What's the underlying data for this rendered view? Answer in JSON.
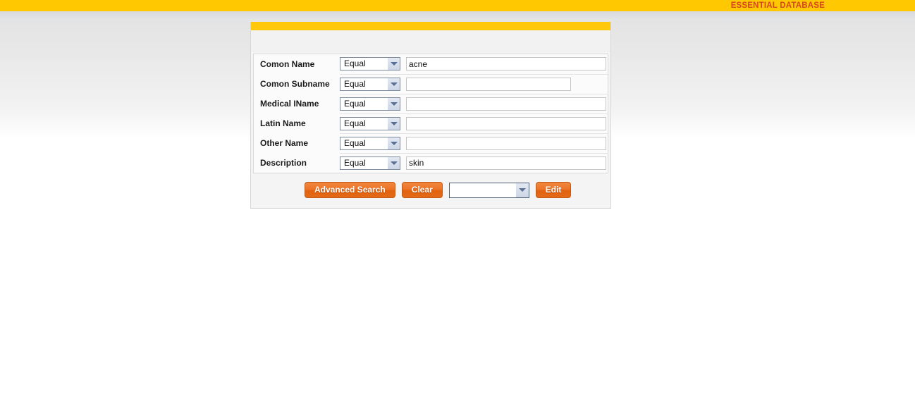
{
  "top_bar": {
    "title": "ESSENTIAL DATABASE",
    "background_color": "#FFC800",
    "text_color": "#D6451C"
  },
  "panel": {
    "header_color": "#FFC80B",
    "background_color": "#f4f4f4"
  },
  "form": {
    "operator_options": [
      "Equal"
    ],
    "rows": [
      {
        "label": "Comon Name",
        "operator": "Equal",
        "value": "acne",
        "placeholder": "",
        "width": "wide"
      },
      {
        "label": "Comon Subname",
        "operator": "Equal",
        "value": "",
        "placeholder": "",
        "width": "short"
      },
      {
        "label": "Medical IName",
        "operator": "Equal",
        "value": "",
        "placeholder": "",
        "width": "wide"
      },
      {
        "label": "Latin Name",
        "operator": "Equal",
        "value": "",
        "placeholder": "",
        "width": "wide"
      },
      {
        "label": "Other Name",
        "operator": "Equal",
        "value": "",
        "placeholder": "",
        "width": "wide"
      },
      {
        "label": "Description",
        "operator": "Equal",
        "value": "skin",
        "placeholder": "",
        "width": "wide"
      }
    ]
  },
  "footer": {
    "advanced_search_label": "Advanced Search",
    "clear_label": "Clear",
    "edit_label": "Edit",
    "selector_value": "",
    "button_color": "#EC7429"
  }
}
